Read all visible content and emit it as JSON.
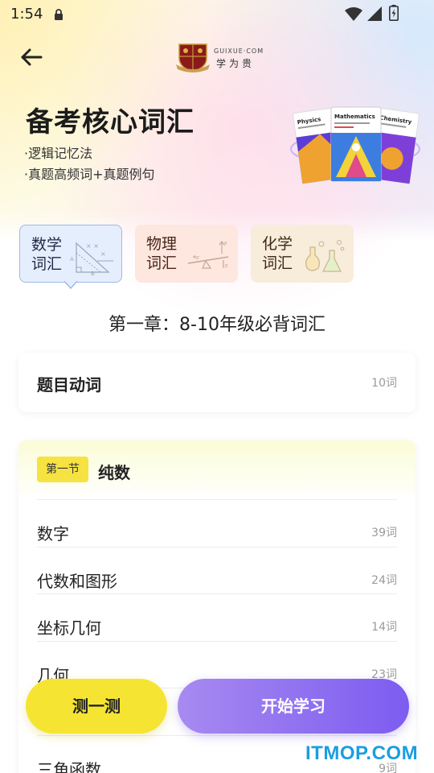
{
  "status_bar": {
    "time": "1:54",
    "icons": [
      "lock-icon",
      "wifi-icon",
      "signal-icon",
      "battery-icon"
    ]
  },
  "header": {
    "back_icon": "arrow-left-icon",
    "logo": {
      "en": "GUIXUE·COM",
      "cn": "学为贵"
    }
  },
  "hero": {
    "title": "备考核心词汇",
    "bullets": [
      "·逻辑记忆法",
      "·真题高频词+真题例句"
    ],
    "books": [
      "Physics",
      "Mathematics",
      "Chemistry"
    ]
  },
  "categories": [
    {
      "label": "数学词汇",
      "selected": true,
      "icon": "geometry-icon"
    },
    {
      "label": "物理词汇",
      "selected": false,
      "icon": "lever-icon"
    },
    {
      "label": "化学词汇",
      "selected": false,
      "icon": "flask-icon"
    }
  ],
  "chapter": {
    "title": "第一章：8-10年级必背词汇"
  },
  "verbs_card": {
    "title": "题目动词",
    "count": "10词"
  },
  "section": {
    "badge": "第一节",
    "name": "纯数",
    "topics": [
      {
        "name": "数字",
        "count": "39词"
      },
      {
        "name": "代数和图形",
        "count": "24词"
      },
      {
        "name": "坐标几何",
        "count": "14词"
      },
      {
        "name": "几何",
        "count": "23词"
      },
      {
        "name": "",
        "count": ""
      },
      {
        "name": "三角函数",
        "count": "9词"
      }
    ]
  },
  "actions": {
    "test_label": "测一测",
    "start_label": "开始学习"
  },
  "watermark": "ITMOP.COM",
  "colors": {
    "accent_yellow": "#f5e532",
    "accent_purple": "#8b6cf0",
    "math_bg": "#e5eefc",
    "physics_bg": "#fde7df",
    "chem_bg": "#f8ecdb",
    "watermark_blue": "#1a9ee0"
  }
}
